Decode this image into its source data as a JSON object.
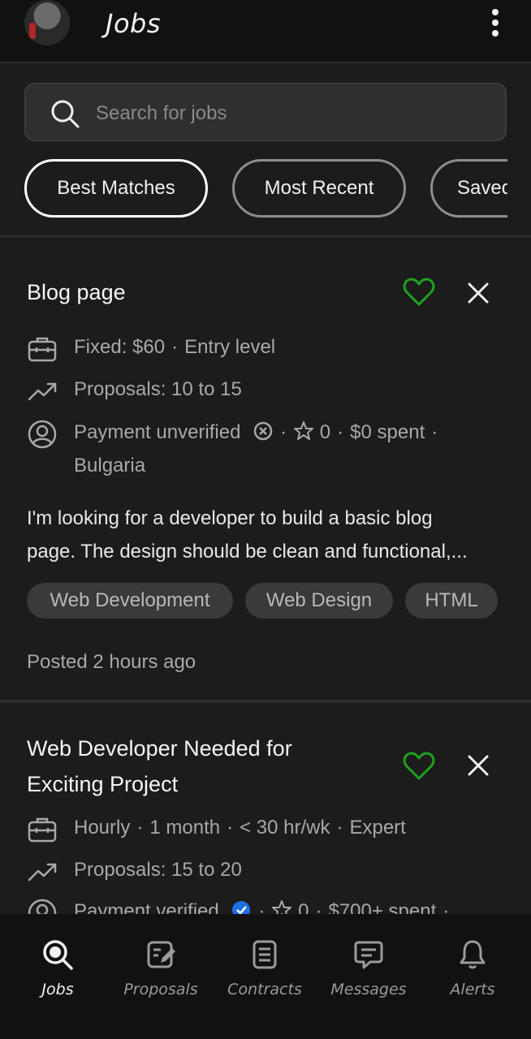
{
  "header": {
    "title": "Jobs"
  },
  "search": {
    "placeholder": "Search for jobs"
  },
  "filters": [
    "Best Matches",
    "Most Recent",
    "Saved"
  ],
  "colors": {
    "accent": "#1fa11f",
    "verified": "#1e6fe0",
    "background": "#1c1c1c"
  },
  "jobs": [
    {
      "title_lines": [
        "Blog page"
      ],
      "type": "Fixed: $60",
      "level": "Entry level",
      "proposals": "Proposals: 10 to 15",
      "payment": "Payment unverified",
      "rating": "0",
      "spent": "$0 spent",
      "country": "Bulgaria",
      "description_lines": [
        "I'm looking for a developer to build a basic blog",
        "page. The design should be clean and functional,..."
      ],
      "skills": [
        "Web Development",
        "Web Design",
        "HTML"
      ],
      "posted": "Posted 2 hours ago"
    },
    {
      "title_lines": [
        "Web Developer Needed for",
        "Exciting Project"
      ],
      "type": "Hourly",
      "duration": "1 month",
      "hours": "< 30 hr/wk",
      "level": "Expert",
      "proposals": "Proposals: 15 to 20",
      "payment": "Payment verified",
      "rating": "0",
      "spent": "$700+ spent"
    }
  ],
  "nav": [
    {
      "label": "Jobs",
      "icon": "search-icon"
    },
    {
      "label": "Proposals",
      "icon": "edit-document-icon"
    },
    {
      "label": "Contracts",
      "icon": "document-list-icon"
    },
    {
      "label": "Messages",
      "icon": "chat-icon"
    },
    {
      "label": "Alerts",
      "icon": "bell-icon"
    }
  ]
}
